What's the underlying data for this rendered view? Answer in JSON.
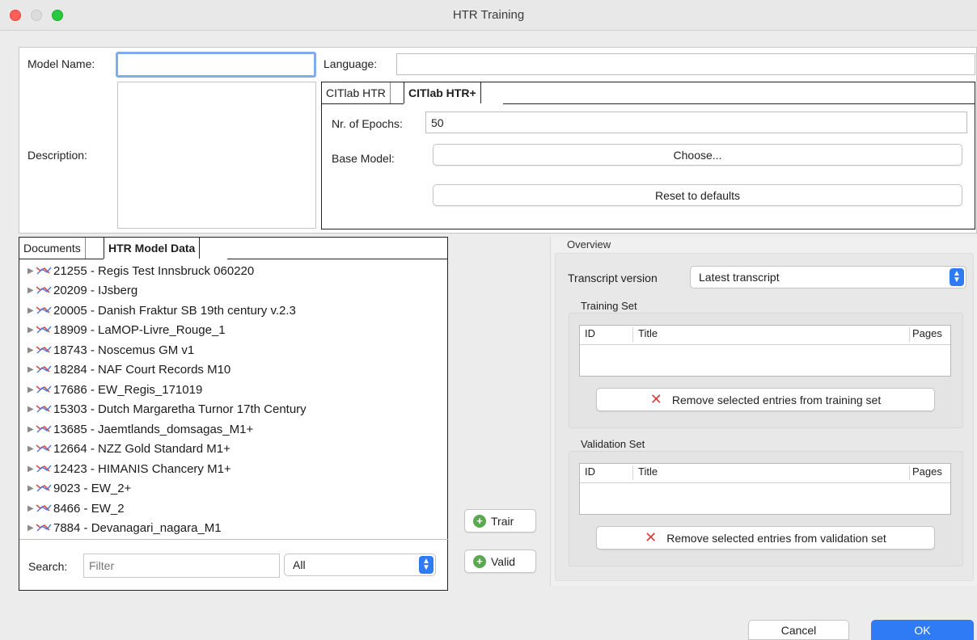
{
  "window": {
    "title": "HTR Training"
  },
  "form": {
    "model_name_label": "Model Name:",
    "model_name_value": "",
    "language_label": "Language:",
    "language_value": "",
    "description_label": "Description:"
  },
  "engine_tabs": {
    "tab1": "CITlab HTR",
    "tab2": "CITlab HTR+",
    "epochs_label": "Nr. of Epochs:",
    "epochs_value": "50",
    "base_model_label": "Base Model:",
    "choose_button": "Choose...",
    "reset_button": "Reset to defaults"
  },
  "data_tabs": {
    "tab1": "Documents",
    "tab2": "HTR Model Data",
    "items": [
      "21255 - Regis Test Innsbruck 060220",
      "20209 - IJsberg",
      "20005 - Danish Fraktur SB 19th century v.2.3",
      "18909 - LaMOP-Livre_Rouge_1",
      "18743 - Noscemus GM v1",
      "18284 - NAF Court Records M10",
      "17686 - EW_Regis_171019",
      "15303 - Dutch Margaretha Turnor 17th Century",
      "13685 - Jaemtlands_domsagas_M1+",
      "12664 - NZZ Gold Standard M1+",
      "12423 - HIMANIS Chancery M1+",
      "9023 - EW_2+",
      "8466 - EW_2",
      "7884 - Devanagari_nagara_M1"
    ],
    "search_label": "Search:",
    "search_placeholder": "Filter",
    "filter_select": "All"
  },
  "middle_buttons": {
    "train": "Trair",
    "valid": "Valid"
  },
  "overview": {
    "title": "Overview",
    "transcript_label": "Transcript version",
    "transcript_value": "Latest transcript",
    "training_set": {
      "title": "Training Set",
      "columns": [
        "ID",
        "Title",
        "Pages"
      ],
      "remove_button": "Remove selected entries from training set"
    },
    "validation_set": {
      "title": "Validation Set",
      "columns": [
        "ID",
        "Title",
        "Pages"
      ],
      "remove_button": "Remove selected entries from validation set"
    }
  },
  "footer": {
    "cancel": "Cancel",
    "ok": "OK"
  },
  "colors": {
    "accent": "#2f7bf5",
    "remove_icon": "#e23a3a",
    "add_icon": "#5aa84f"
  }
}
